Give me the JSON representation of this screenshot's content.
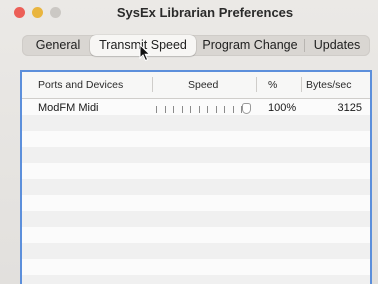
{
  "window": {
    "title": "SysEx Librarian Preferences",
    "traffic_colors": {
      "close": "#ec5f57",
      "minimize": "#e9b53f",
      "zoom": "#cbc8c4"
    }
  },
  "tabs": {
    "items": [
      {
        "label": "General",
        "active": false
      },
      {
        "label": "Transmit Speed",
        "active": true
      },
      {
        "label": "Program Change",
        "active": false
      },
      {
        "label": "Updates",
        "active": false
      }
    ]
  },
  "table": {
    "columns": [
      "Ports and Devices",
      "Speed",
      "%",
      "Bytes/sec"
    ],
    "rows": [
      {
        "device": "ModFM Midi",
        "speed_fraction": 1.0,
        "percent": "100%",
        "bytes_per_sec": "3125"
      }
    ]
  },
  "accent_color": "#5c8fdb"
}
